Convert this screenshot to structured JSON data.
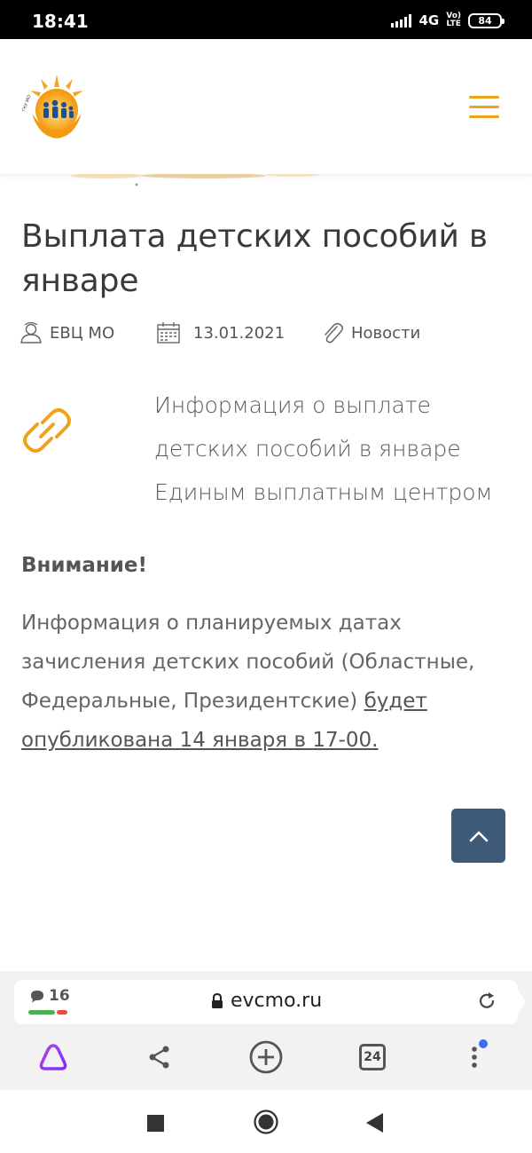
{
  "status_bar": {
    "time": "18:41",
    "network": "4G",
    "network_sub": "Vo)) LTE",
    "battery": "84"
  },
  "header": {
    "logo_icon": "evc-sun-family-logo-icon",
    "menu_icon": "hamburger-menu-icon",
    "accent_color": "#f0a318"
  },
  "article": {
    "title": "Выплата детских пособий в январе",
    "author": "ЕВЦ МО",
    "date": "13.01.2021",
    "category": "Новости",
    "lead": "Информация о выплате детских пособий в январе Единым выплатным центром",
    "attention": "Внимание!",
    "body_plain": "Информация о планируемых датах зачисления детских пособий (Областные, Федеральные, Президентские) ",
    "body_link": "будет опубликована 14 января в 17-00."
  },
  "scroll_top": {
    "icon": "chevron-up-icon",
    "color": "#3d5a78"
  },
  "browser": {
    "tabs_count": "16",
    "url": "evcmo.ru",
    "tabs_button": "24"
  }
}
